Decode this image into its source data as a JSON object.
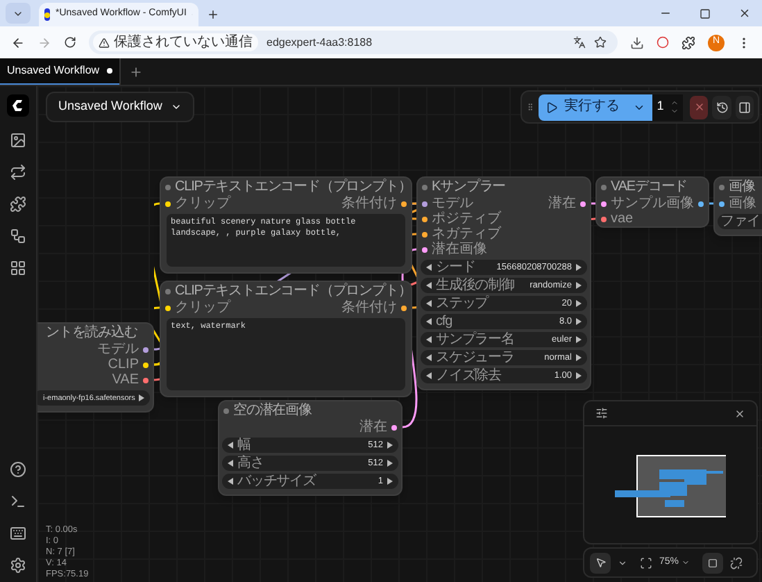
{
  "browser": {
    "tab_title": "*Unsaved Workflow - ComfyUI",
    "security_label": "保護されていない通信",
    "url": "edgexpert-4aa3:8188",
    "profile_initial": "N"
  },
  "app_tabs": [
    {
      "label": "Unsaved Workflow",
      "selected": true,
      "modified": true
    }
  ],
  "workflow_menu": {
    "label": "Unsaved Workflow"
  },
  "queue_toolbar": {
    "run_label": "実行する",
    "batch_count": "1"
  },
  "nodes": [
    {
      "title": "CLIPテキストエンコード（プロンプト）",
      "inputs": [
        {
          "label": "クリップ",
          "color": "#ffd500"
        }
      ],
      "outputs": [
        {
          "label": "条件付け",
          "color": "#ffa931"
        }
      ],
      "text": "beautiful scenery nature glass bottle landscape, , purple galaxy bottle,"
    },
    {
      "title": "Kサンプラー",
      "inputs": [
        {
          "label": "モデル",
          "color": "#b39ddb"
        },
        {
          "label": "ポジティブ",
          "color": "#ffa931"
        },
        {
          "label": "ネガティブ",
          "color": "#ffa931"
        },
        {
          "label": "潜在画像",
          "color": "#ff9cf9"
        }
      ],
      "outputs": [
        {
          "label": "潜在",
          "color": "#ff9cf9"
        }
      ],
      "widgets": [
        {
          "label": "シード",
          "value": "156680208700288"
        },
        {
          "label": "生成後の制御",
          "value": "randomize"
        },
        {
          "label": "ステップ",
          "value": "20"
        },
        {
          "label": "cfg",
          "value": "8.0"
        },
        {
          "label": "サンプラー名",
          "value": "euler"
        },
        {
          "label": "スケジューラ",
          "value": "normal"
        },
        {
          "label": "ノイズ除去",
          "value": "1.00"
        }
      ]
    },
    {
      "title": "VAEデコード",
      "inputs": [
        {
          "label": "サンプル",
          "color": "#ff9cf9"
        },
        {
          "label": "vae",
          "color": "#ff6e6e"
        }
      ],
      "outputs": [
        {
          "label": "画像",
          "color": "#64b5f6"
        }
      ]
    },
    {
      "title": "画像",
      "inputs": [
        {
          "label": "画像",
          "color": "#64b5f6"
        }
      ],
      "widgets": [
        {
          "label": "ファイ"
        }
      ]
    },
    {
      "title": "CLIPテキストエンコード（プロンプト）",
      "inputs": [
        {
          "label": "クリップ",
          "color": "#ffd500"
        }
      ],
      "outputs": [
        {
          "label": "条件付け",
          "color": "#ffa931"
        }
      ],
      "text": "text, watermark"
    },
    {
      "title": "ントを読み込む",
      "outputs": [
        {
          "label": "モデル",
          "color": "#b39ddb"
        },
        {
          "label": "CLIP",
          "color": "#ffd500"
        },
        {
          "label": "VAE",
          "color": "#ff6e6e"
        }
      ],
      "widgets": [
        {
          "value": "i-emaonly-fp16.safetensors"
        }
      ]
    },
    {
      "title": "空の潜在画像",
      "outputs": [
        {
          "label": "潜在",
          "color": "#ff9cf9"
        }
      ],
      "widgets": [
        {
          "label": "幅",
          "value": "512"
        },
        {
          "label": "高さ",
          "value": "512"
        },
        {
          "label": "バッチサイズ",
          "value": "1"
        }
      ]
    }
  ],
  "stats": [
    "T: 0.00s",
    "I: 0",
    "N: 7 [7]",
    "V: 14",
    "FPS:75.19"
  ],
  "canvas_toolbar": {
    "zoom": "75%"
  }
}
